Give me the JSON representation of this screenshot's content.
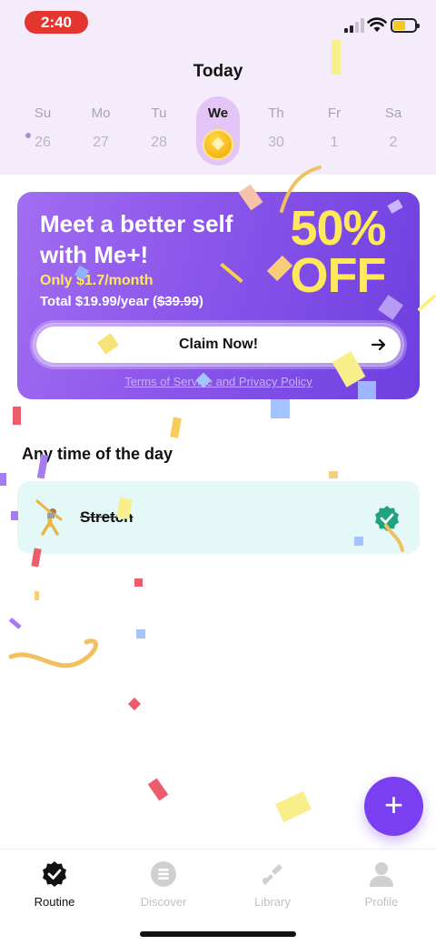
{
  "status_bar": {
    "time": "2:40"
  },
  "header": {
    "title": "Today"
  },
  "week": [
    {
      "day": "Su",
      "date": "26"
    },
    {
      "day": "Mo",
      "date": "27"
    },
    {
      "day": "Tu",
      "date": "28"
    },
    {
      "day": "We",
      "date": ""
    },
    {
      "day": "Th",
      "date": "30"
    },
    {
      "day": "Fr",
      "date": "1"
    },
    {
      "day": "Sa",
      "date": "2"
    }
  ],
  "promo": {
    "headline": "Meet a better self with Me+!",
    "price": "Only $1.7/month",
    "total_prefix": "Total $19.99/year (",
    "total_old": "$39.99",
    "total_suffix": ")",
    "discount_line1": "50%",
    "discount_line2": "OFF",
    "cta_label": "Claim Now!",
    "terms": "Terms of Service and Privacy Policy"
  },
  "section": {
    "title": "Any time of the day"
  },
  "habits": [
    {
      "name": "Stretch",
      "completed": true
    }
  ],
  "fab": {
    "label": "+"
  },
  "tabs": [
    {
      "label": "Routine",
      "icon": "badge-check-icon",
      "active": true
    },
    {
      "label": "Discover",
      "icon": "discover-icon",
      "active": false
    },
    {
      "label": "Library",
      "icon": "library-icon",
      "active": false
    },
    {
      "label": "Profile",
      "icon": "profile-icon",
      "active": false
    }
  ],
  "colors": {
    "accent": "#7a3ff0",
    "promo_highlight": "#ffe95a",
    "time_pill": "#e5352f",
    "habit_card": "#e4f8f8"
  }
}
